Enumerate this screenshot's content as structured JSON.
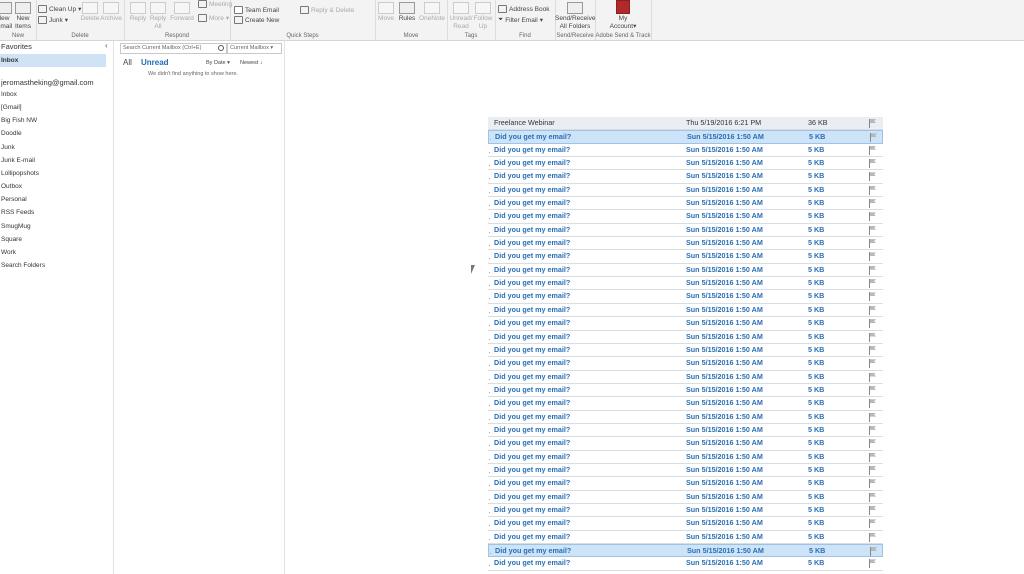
{
  "ribbon": {
    "groups": {
      "new": "New",
      "delete": "Delete",
      "respond": "Respond",
      "quick_steps": "Quick Steps",
      "move": "Move",
      "tags": "Tags",
      "find": "Find",
      "send_receive": "Send/Receive",
      "adobe": "Adobe Send & Track"
    },
    "new_email_1": "New",
    "new_email_2": "Email",
    "new_items_1": "New",
    "new_items_2": "Items",
    "clean_up": "Clean Up",
    "junk": "Junk",
    "delete_btn": "Delete",
    "archive_btn": "Archive",
    "reply": "Reply",
    "reply_all_1": "Reply",
    "reply_all_2": "All",
    "forward": "Forward",
    "meeting": "Meeting",
    "more_respond": "More",
    "team_email": "Team Email",
    "create_new": "Create New",
    "reply_delete": "Reply & Delete",
    "move_btn": "Move",
    "rules": "Rules",
    "onenote": "OneNote",
    "unread_read_1": "Unread/",
    "unread_read_2": "Read",
    "follow_up_1": "Follow",
    "follow_up_2": "Up",
    "address_book": "Address Book",
    "filter_email": "Filter Email",
    "send_receive_1": "Send/Receive",
    "send_receive_2": "All Folders",
    "my_account_1": "My",
    "my_account_2": "Account"
  },
  "folders": {
    "favorites_header": "Favorites",
    "favorite_inbox": "Inbox",
    "account": "jeromastheking@gmail.com",
    "items": [
      "Inbox",
      "[Gmail]",
      "Big Fish NW",
      "Doodle",
      "Junk",
      "Junk E-mail",
      "Lollipopshots",
      "Outbox",
      "Personal",
      "RSS Feeds",
      "SmugMug",
      "Square",
      "Work",
      "Search Folders"
    ]
  },
  "list": {
    "search_placeholder": "Search Current Mailbox (Ctrl+E)",
    "scope": "Current Mailbox",
    "tab_all": "All",
    "tab_unread": "Unread",
    "sort_by": "By Date",
    "order": "Newest",
    "empty_message": "We didn't find anything to show here."
  },
  "messages": [
    {
      "subject": "Freelance Webinar",
      "date": "Thu 5/19/2016 6:21 PM",
      "size": "36 KB"
    },
    {
      "subject": "Did you get my email?",
      "date": "Sun 5/15/2016 1:50 AM",
      "size": "5 KB"
    },
    {
      "subject": "Did you get my email?",
      "date": "Sun 5/15/2016 1:50 AM",
      "size": "5 KB"
    },
    {
      "subject": "Did you get my email?",
      "date": "Sun 5/15/2016 1:50 AM",
      "size": "5 KB"
    },
    {
      "subject": "Did you get my email?",
      "date": "Sun 5/15/2016 1:50 AM",
      "size": "5 KB"
    },
    {
      "subject": "Did you get my email?",
      "date": "Sun 5/15/2016 1:50 AM",
      "size": "5 KB"
    },
    {
      "subject": "Did you get my email?",
      "date": "Sun 5/15/2016 1:50 AM",
      "size": "5 KB"
    },
    {
      "subject": "Did you get my email?",
      "date": "Sun 5/15/2016 1:50 AM",
      "size": "5 KB"
    },
    {
      "subject": "Did you get my email?",
      "date": "Sun 5/15/2016 1:50 AM",
      "size": "5 KB"
    },
    {
      "subject": "Did you get my email?",
      "date": "Sun 5/15/2016 1:50 AM",
      "size": "5 KB"
    },
    {
      "subject": "Did you get my email?",
      "date": "Sun 5/15/2016 1:50 AM",
      "size": "5 KB"
    },
    {
      "subject": "Did you get my email?",
      "date": "Sun 5/15/2016 1:50 AM",
      "size": "5 KB"
    },
    {
      "subject": "Did you get my email?",
      "date": "Sun 5/15/2016 1:50 AM",
      "size": "5 KB"
    },
    {
      "subject": "Did you get my email?",
      "date": "Sun 5/15/2016 1:50 AM",
      "size": "5 KB"
    },
    {
      "subject": "Did you get my email?",
      "date": "Sun 5/15/2016 1:50 AM",
      "size": "5 KB"
    },
    {
      "subject": "Did you get my email?",
      "date": "Sun 5/15/2016 1:50 AM",
      "size": "5 KB"
    },
    {
      "subject": "Did you get my email?",
      "date": "Sun 5/15/2016 1:50 AM",
      "size": "5 KB"
    },
    {
      "subject": "Did you get my email?",
      "date": "Sun 5/15/2016 1:50 AM",
      "size": "5 KB"
    },
    {
      "subject": "Did you get my email?",
      "date": "Sun 5/15/2016 1:50 AM",
      "size": "5 KB"
    },
    {
      "subject": "Did you get my email?",
      "date": "Sun 5/15/2016 1:50 AM",
      "size": "5 KB"
    },
    {
      "subject": "Did you get my email?",
      "date": "Sun 5/15/2016 1:50 AM",
      "size": "5 KB"
    },
    {
      "subject": "Did you get my email?",
      "date": "Sun 5/15/2016 1:50 AM",
      "size": "5 KB"
    },
    {
      "subject": "Did you get my email?",
      "date": "Sun 5/15/2016 1:50 AM",
      "size": "5 KB"
    },
    {
      "subject": "Did you get my email?",
      "date": "Sun 5/15/2016 1:50 AM",
      "size": "5 KB"
    },
    {
      "subject": "Did you get my email?",
      "date": "Sun 5/15/2016 1:50 AM",
      "size": "5 KB"
    },
    {
      "subject": "Did you get my email?",
      "date": "Sun 5/15/2016 1:50 AM",
      "size": "5 KB"
    },
    {
      "subject": "Did you get my email?",
      "date": "Sun 5/15/2016 1:50 AM",
      "size": "5 KB"
    },
    {
      "subject": "Did you get my email?",
      "date": "Sun 5/15/2016 1:50 AM",
      "size": "5 KB"
    },
    {
      "subject": "Did you get my email?",
      "date": "Sun 5/15/2016 1:50 AM",
      "size": "5 KB"
    },
    {
      "subject": "Did you get my email?",
      "date": "Sun 5/15/2016 1:50 AM",
      "size": "5 KB"
    },
    {
      "subject": "Did you get my email?",
      "date": "Sun 5/15/2016 1:50 AM",
      "size": "5 KB"
    },
    {
      "subject": "Did you get my email?",
      "date": "Sun 5/15/2016 1:50 AM",
      "size": "5 KB"
    },
    {
      "subject": "Did you get my email?",
      "date": "Sun 5/15/2016 1:50 AM",
      "size": "5 KB"
    },
    {
      "subject": "Did you get my email?",
      "date": "Sun 5/15/2016 1:50 AM",
      "size": "5 KB"
    }
  ]
}
